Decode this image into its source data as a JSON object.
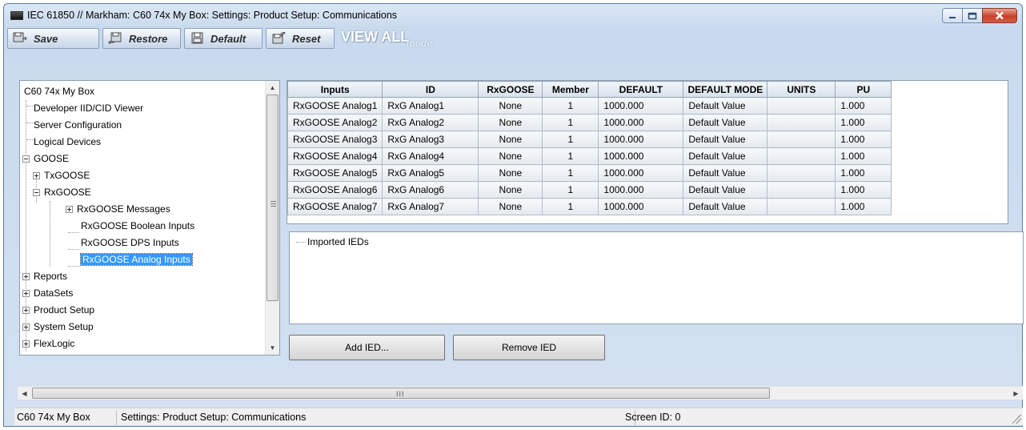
{
  "window": {
    "title": "IEC 61850 // Markham: C60 74x My Box: Settings: Product Setup: Communications"
  },
  "toolbar": {
    "save_label": "Save",
    "restore_label": "Restore",
    "default_label": "Default",
    "reset_label": "Reset",
    "view_all_label": "VIEW ALL",
    "view_mode_label": "mode"
  },
  "tree": {
    "root": "C60 74x My Box",
    "items": {
      "developer": "Developer IID/CID Viewer",
      "server_config": "Server Configuration",
      "logical_devices": "Logical Devices",
      "goose": "GOOSE",
      "txgoose": "TxGOOSE",
      "rxgoose": "RxGOOSE",
      "rx_messages": "RxGOOSE Messages",
      "rx_boolean": "RxGOOSE Boolean Inputs",
      "rx_dps": "RxGOOSE DPS Inputs",
      "rx_analog": "RxGOOSE Analog Inputs",
      "reports": "Reports",
      "datasets": "DataSets",
      "product_setup": "Product Setup",
      "system_setup": "System Setup",
      "flexlogic": "FlexLogic"
    }
  },
  "grid": {
    "headers": [
      "Inputs",
      "ID",
      "RxGOOSE",
      "Member",
      "DEFAULT",
      "DEFAULT MODE",
      "UNITS",
      "PU"
    ],
    "rows": [
      [
        "RxGOOSE Analog1",
        "RxG Analog1",
        "None",
        "1",
        "1000.000",
        "Default Value",
        "",
        "1.000"
      ],
      [
        "RxGOOSE Analog2",
        "RxG Analog2",
        "None",
        "1",
        "1000.000",
        "Default Value",
        "",
        "1.000"
      ],
      [
        "RxGOOSE Analog3",
        "RxG Analog3",
        "None",
        "1",
        "1000.000",
        "Default Value",
        "",
        "1.000"
      ],
      [
        "RxGOOSE Analog4",
        "RxG Analog4",
        "None",
        "1",
        "1000.000",
        "Default Value",
        "",
        "1.000"
      ],
      [
        "RxGOOSE Analog5",
        "RxG Analog5",
        "None",
        "1",
        "1000.000",
        "Default Value",
        "",
        "1.000"
      ],
      [
        "RxGOOSE Analog6",
        "RxG Analog6",
        "None",
        "1",
        "1000.000",
        "Default Value",
        "",
        "1.000"
      ],
      [
        "RxGOOSE Analog7",
        "RxG Analog7",
        "None",
        "1",
        "1000.000",
        "Default Value",
        "",
        "1.000"
      ]
    ]
  },
  "ied_panel": {
    "root_label": "Imported IEDs"
  },
  "buttons": {
    "add_ied": "Add IED...",
    "remove_ied": "Remove IED"
  },
  "statusbar": {
    "device": "C60 74x My Box",
    "path": "Settings: Product Setup: Communications",
    "screen_id": "Screen ID: 0"
  },
  "colors": {
    "selection": "#3399ff",
    "close_button": "#c8402a",
    "frame": "#c9daee"
  }
}
